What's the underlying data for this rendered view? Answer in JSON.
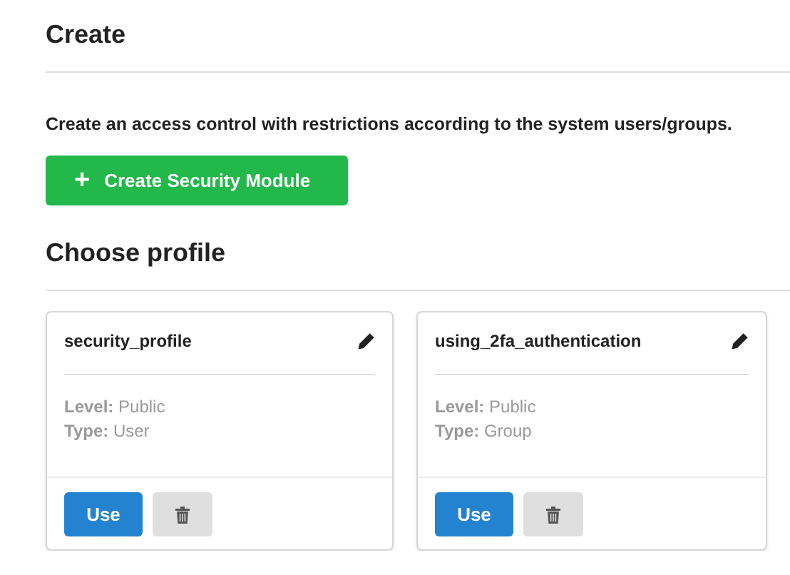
{
  "create_section": {
    "heading": "Create",
    "description": "Create an access control with restrictions according to the system users/groups.",
    "button": {
      "icon": "+",
      "label": "Create Security Module"
    }
  },
  "profile_section": {
    "heading": "Choose profile",
    "profiles": [
      {
        "name": "security_profile",
        "fields": [
          {
            "label": "Level:",
            "value": "Public"
          },
          {
            "label": "Type:",
            "value": "User"
          }
        ],
        "use_label": "Use"
      },
      {
        "name": "using_2fa_authentication",
        "fields": [
          {
            "label": "Level:",
            "value": "Public"
          },
          {
            "label": "Type:",
            "value": "Group"
          }
        ],
        "use_label": "Use"
      }
    ]
  }
}
